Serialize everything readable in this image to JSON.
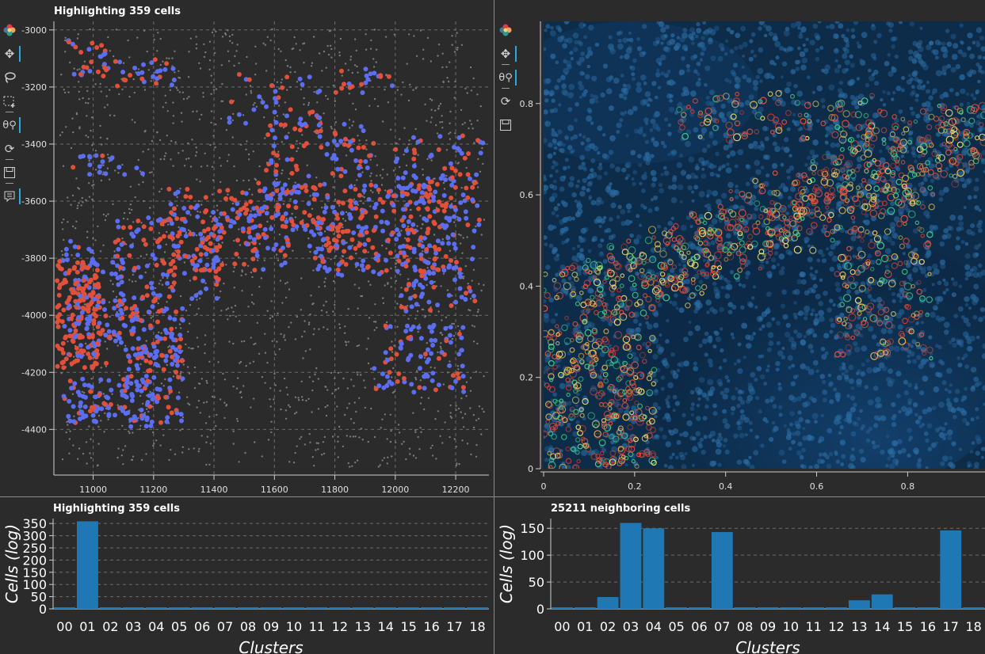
{
  "scatter_panel": {
    "title": "Highlighting 359 cells"
  },
  "image_panel": {},
  "hist_left": {
    "title": "Highlighting 359 cells"
  },
  "hist_right": {
    "title": "25211 neighboring cells"
  },
  "toolbar": {
    "icons": [
      "bokeh-logo-icon",
      "pan-icon",
      "lasso-select-icon",
      "box-select-icon",
      "wheel-zoom-icon",
      "reset-icon",
      "save-icon",
      "hover-icon"
    ]
  },
  "colors": {
    "background": "#2b2b2b",
    "grid": "#6e6e6e",
    "selected_red": "#e0503a",
    "selected_blue": "#5b6df0",
    "unselected": "#7a7a7a",
    "bar": "#1f77b4",
    "active_tool": "#26aae1"
  },
  "chart_data": [
    {
      "type": "scatter",
      "title": "Highlighting 359 cells",
      "xlim": [
        10870,
        12310
      ],
      "ylim": [
        -4560,
        -2970
      ],
      "xticks": [
        11000,
        11200,
        11400,
        11600,
        11800,
        12000,
        12200
      ],
      "yticks": [
        -3000,
        -3200,
        -3400,
        -3600,
        -3800,
        -4000,
        -4200,
        -4400
      ],
      "series": [
        {
          "values_desc": "highlighted cells, red and blue points"
        },
        {
          "values_desc": "grey background points"
        }
      ],
      "grid": true
    },
    {
      "type": "image",
      "xlim": [
        0,
        0.97
      ],
      "ylim": [
        0,
        0.98
      ],
      "xticks": [
        "0",
        "0.2",
        "0.4",
        "0.6",
        "0.8"
      ],
      "yticks": [
        "0",
        "0.2",
        "0.4",
        "0.6",
        "0.8"
      ],
      "xtick_values": [
        0,
        0.2,
        0.4,
        0.6,
        0.8
      ],
      "ytick_values": [
        0,
        0.2,
        0.4,
        0.6,
        0.8
      ]
    },
    {
      "type": "bar",
      "title": "Highlighting 359 cells",
      "xlabel": "Clusters",
      "ylabel": "Cells (log)",
      "categories": [
        "00",
        "01",
        "02",
        "03",
        "04",
        "05",
        "06",
        "07",
        "08",
        "09",
        "10",
        "11",
        "12",
        "13",
        "14",
        "15",
        "16",
        "17",
        "18"
      ],
      "values": [
        0,
        359,
        0,
        0,
        0,
        0,
        0,
        0,
        0,
        0,
        0,
        0,
        0,
        0,
        0,
        0,
        0,
        0,
        0
      ],
      "ylim": [
        0,
        370
      ],
      "yticks": [
        "0",
        "50",
        "100",
        "150",
        "200",
        "250",
        "300",
        "350"
      ],
      "ytick_values": [
        0,
        50,
        100,
        150,
        200,
        250,
        300,
        350
      ],
      "grid": true
    },
    {
      "type": "bar",
      "title": "25211 neighboring cells",
      "xlabel": "Clusters",
      "ylabel": "Cells (log)",
      "categories": [
        "00",
        "01",
        "02",
        "03",
        "04",
        "05",
        "06",
        "07",
        "08",
        "09",
        "10",
        "11",
        "12",
        "13",
        "14",
        "15",
        "16",
        "17",
        "18"
      ],
      "values": [
        0,
        0,
        22,
        160,
        150,
        0,
        2,
        143,
        0,
        0,
        0,
        0,
        2,
        16,
        27,
        2,
        0,
        146,
        0
      ],
      "ylim": [
        0,
        168
      ],
      "yticks": [
        "0",
        "50",
        "100",
        "150"
      ],
      "ytick_values": [
        0,
        50,
        100,
        150
      ],
      "grid": true
    }
  ]
}
